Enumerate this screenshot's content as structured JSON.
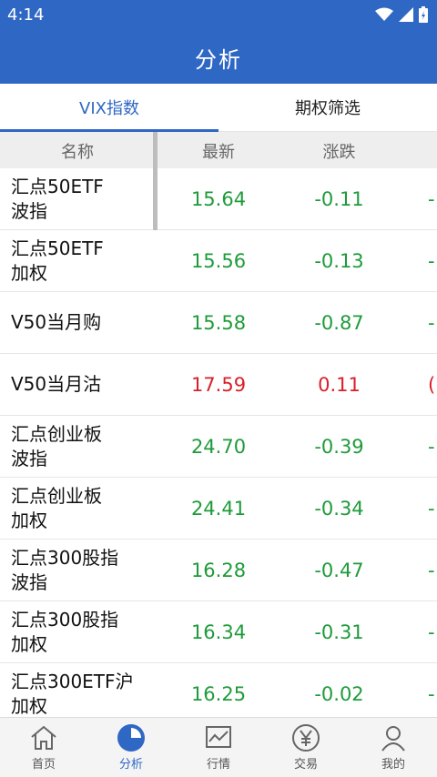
{
  "status": {
    "time": "4:14",
    "icons": [
      "wifi-icon",
      "signal-icon",
      "battery-icon"
    ]
  },
  "appbar": {
    "title": "分析"
  },
  "tabs": [
    {
      "label": "VIX指数",
      "active": true
    },
    {
      "label": "期权筛选",
      "active": false
    }
  ],
  "table": {
    "headers": {
      "name": "名称",
      "latest": "最新",
      "change": "涨跌"
    },
    "rows": [
      {
        "name1": "汇点50ETF",
        "name2": "波指",
        "latest": "15.64",
        "change": "-0.11",
        "extra": "-",
        "dir": "down"
      },
      {
        "name1": "汇点50ETF",
        "name2": "加权",
        "latest": "15.56",
        "change": "-0.13",
        "extra": "-",
        "dir": "down"
      },
      {
        "name1": "V50当月购",
        "name2": "",
        "latest": "15.58",
        "change": "-0.87",
        "extra": "-",
        "dir": "down"
      },
      {
        "name1": "V50当月沽",
        "name2": "",
        "latest": "17.59",
        "change": "0.11",
        "extra": "(",
        "dir": "up"
      },
      {
        "name1": "汇点创业板",
        "name2": "波指",
        "latest": "24.70",
        "change": "-0.39",
        "extra": "-",
        "dir": "down"
      },
      {
        "name1": "汇点创业板",
        "name2": "加权",
        "latest": "24.41",
        "change": "-0.34",
        "extra": "-",
        "dir": "down"
      },
      {
        "name1": "汇点300股指",
        "name2": "波指",
        "latest": "16.28",
        "change": "-0.47",
        "extra": "-",
        "dir": "down"
      },
      {
        "name1": "汇点300股指",
        "name2": "加权",
        "latest": "16.34",
        "change": "-0.31",
        "extra": "-",
        "dir": "down"
      },
      {
        "name1": "汇点300ETF沪",
        "name2": "加权",
        "latest": "16.25",
        "change": "-0.02",
        "extra": "-",
        "dir": "down"
      }
    ]
  },
  "bottomnav": [
    {
      "label": "首页",
      "icon": "home-icon",
      "active": false
    },
    {
      "label": "分析",
      "icon": "pie-chart-icon",
      "active": true
    },
    {
      "label": "行情",
      "icon": "line-chart-icon",
      "active": false
    },
    {
      "label": "交易",
      "icon": "yen-icon",
      "active": false
    },
    {
      "label": "我的",
      "icon": "user-icon",
      "active": false
    }
  ],
  "colors": {
    "brand": "#2f67c5",
    "up": "#d81f2a",
    "down": "#1e9b3a"
  }
}
